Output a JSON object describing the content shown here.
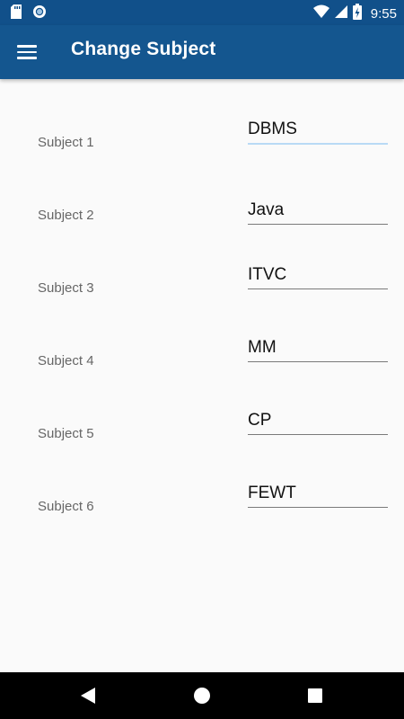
{
  "status_bar": {
    "time": "9:55",
    "icons": [
      "sd-card-icon",
      "sync-circle-icon",
      "wifi-icon",
      "signal-icon",
      "battery-charging-icon"
    ]
  },
  "app_bar": {
    "title": "Change Subject",
    "menu_icon": "hamburger-menu-icon"
  },
  "subjects": [
    {
      "label": "Subject 1",
      "value": "DBMS"
    },
    {
      "label": "Subject 2",
      "value": "Java"
    },
    {
      "label": "Subject 3",
      "value": "ITVC"
    },
    {
      "label": "Subject 4",
      "value": "MM"
    },
    {
      "label": "Subject 5",
      "value": "CP"
    },
    {
      "label": "Subject 6",
      "value": "FEWT"
    }
  ],
  "nav_bar": {
    "icons": [
      "back-icon",
      "home-icon",
      "recents-icon"
    ]
  },
  "colors": {
    "status_bar": "#11508a",
    "app_bar": "#14568f",
    "background": "#fafafa",
    "focused_underline": "#b9daf5"
  }
}
